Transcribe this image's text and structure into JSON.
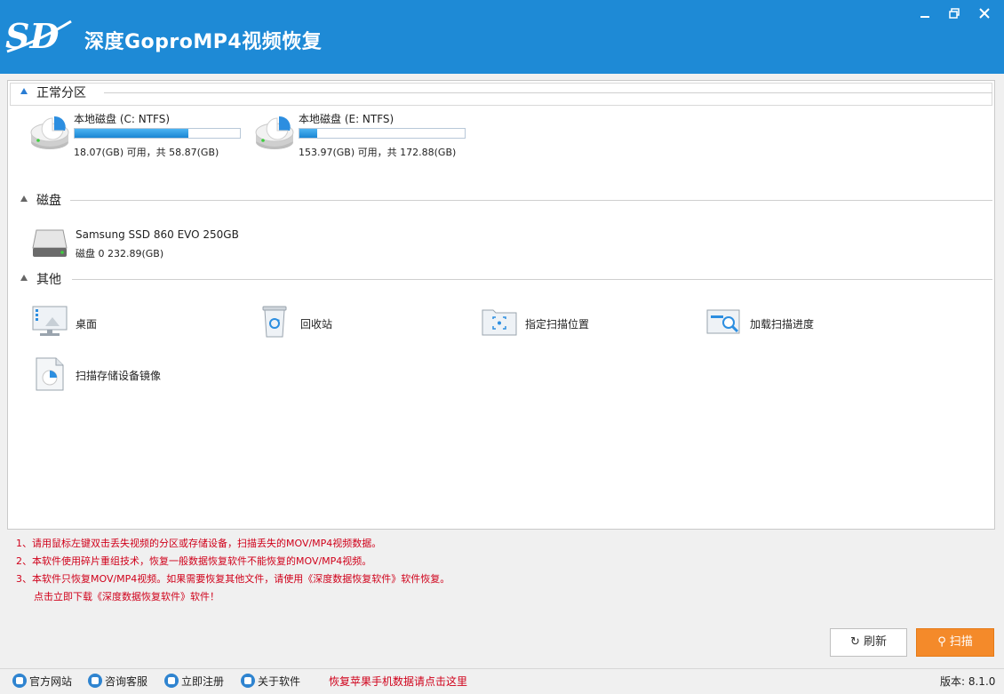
{
  "app": {
    "title": "深度GoproMP4视频恢复",
    "window_controls": [
      "minimize-icon",
      "restore-icon",
      "close-icon"
    ],
    "accent": "#1e8ad6"
  },
  "sections": {
    "partitions_title": "正常分区",
    "disks_title": "磁盘",
    "others_title": "其他"
  },
  "partitions": [
    {
      "name": "本地磁盘 (C: NTFS)",
      "capacity": "18.07(GB) 可用，共 58.87(GB)",
      "used_fraction": 0.69
    },
    {
      "name": "本地磁盘 (E: NTFS)",
      "capacity": "153.97(GB) 可用，共 172.88(GB)",
      "used_fraction": 0.11
    }
  ],
  "disks": [
    {
      "name": "Samsung SSD 860 EVO 250GB",
      "sub": "磁盘 0    232.89(GB)"
    }
  ],
  "others": [
    {
      "label": "桌面",
      "icon": "desktop-icon"
    },
    {
      "label": "回收站",
      "icon": "recycle-bin-icon"
    },
    {
      "label": "指定扫描位置",
      "icon": "folder-scan-icon"
    },
    {
      "label": "加载扫描进度",
      "icon": "load-progress-icon"
    },
    {
      "label": "扫描存储设备镜像",
      "icon": "disk-image-icon"
    }
  ],
  "notes": [
    "1、请用鼠标左键双击丢失视频的分区或存储设备，扫描丢失的MOV/MP4视频数据。",
    "2、本软件使用碎片重组技术，恢复一般数据恢复软件不能恢复的MOV/MP4视频。",
    "3、本软件只恢复MOV/MP4视频。如果需要恢复其他文件，请使用《深度数据恢复软件》软件恢复。",
    "点击立即下载《深度数据恢复软件》软件！"
  ],
  "buttons": {
    "refresh": "刷新",
    "scan": "扫描"
  },
  "statusbar": {
    "official_site": "官方网站",
    "support": "咨询客服",
    "register": "立即注册",
    "about": "关于软件",
    "promo": "恢复苹果手机数据请点击这里",
    "version": "版本: 8.1.0"
  }
}
